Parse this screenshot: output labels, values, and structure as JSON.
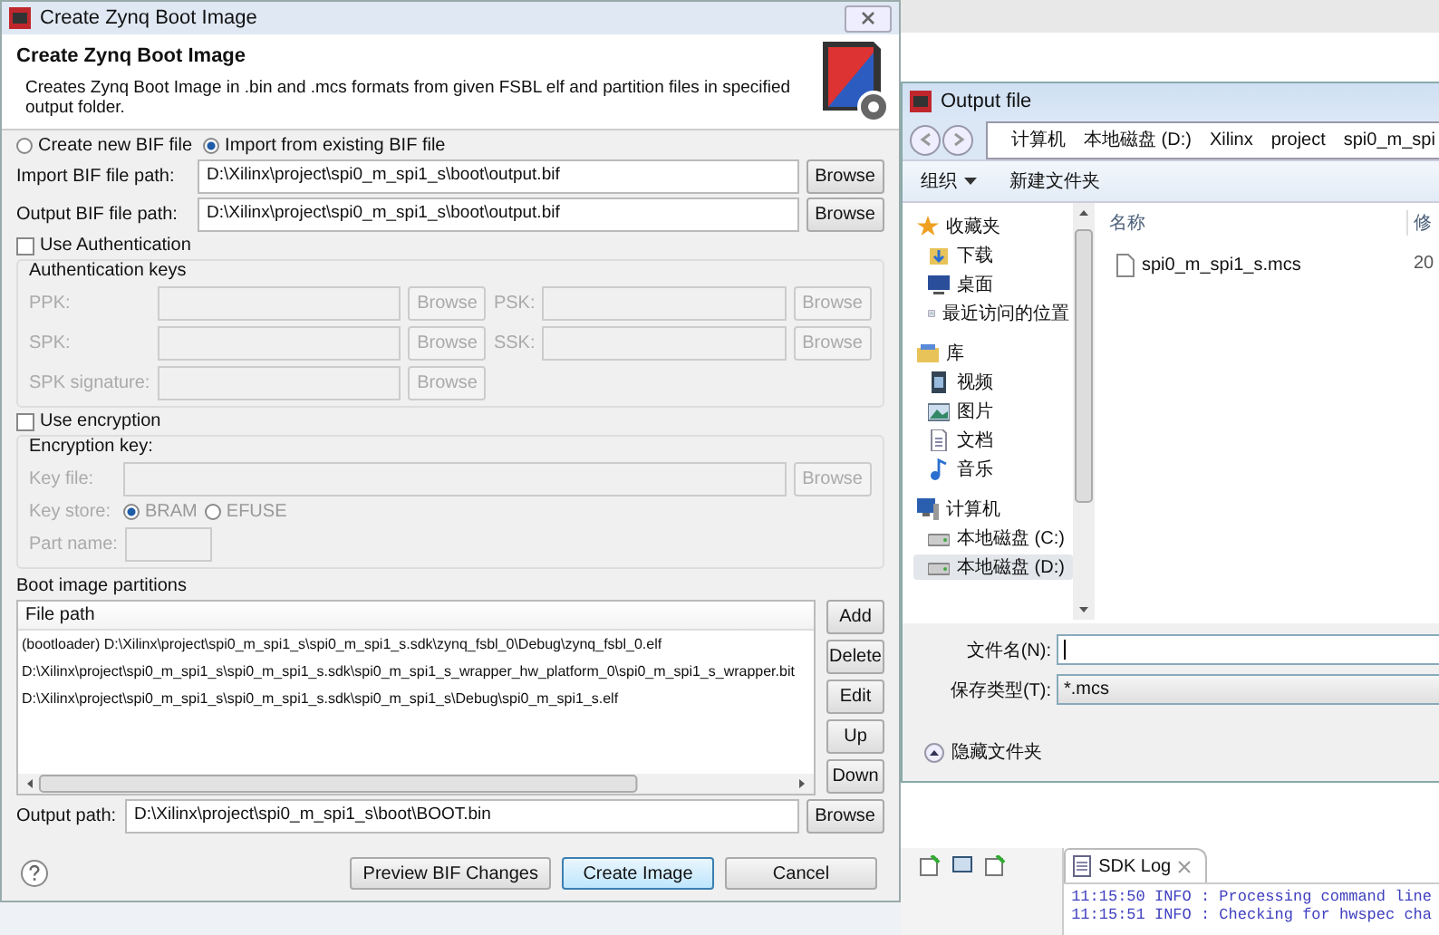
{
  "main_dialog": {
    "title": "Create Zynq Boot Image",
    "heading": "Create Zynq Boot Image",
    "description": "Creates Zynq Boot Image in .bin and .mcs formats from given FSBL elf and partition files in specified output folder.",
    "bif_mode": [
      {
        "label": "Create new BIF file",
        "selected": false
      },
      {
        "label": "Import from existing BIF file",
        "selected": true
      }
    ],
    "bif_paths": [
      {
        "label": "Import BIF file path:",
        "value": "D:\\Xilinx\\project\\spi0_m_spi1_s\\boot\\output.bif",
        "button": "Browse"
      },
      {
        "label": "Output BIF file path:",
        "value": "D:\\Xilinx\\project\\spi0_m_spi1_s\\boot\\output.bif",
        "button": "Browse"
      }
    ],
    "authentication": {
      "label": "Use Authentication",
      "checked": false,
      "group_title": "Authentication keys",
      "keys": [
        {
          "label": "PPK:",
          "button": "Browse"
        },
        {
          "label": "PSK:",
          "button": "Browse"
        },
        {
          "label": "SPK:",
          "button": "Browse"
        },
        {
          "label": "SSK:",
          "button": "Browse"
        },
        {
          "label": "SPK signature:",
          "button": "Browse"
        }
      ]
    },
    "encryption": {
      "label": "Use encryption",
      "checked": false,
      "group_title": "Encryption key:",
      "key_file": {
        "label": "Key file:",
        "button": "Browse"
      },
      "key_store": {
        "label": "Key store:",
        "options": [
          {
            "label": "BRAM",
            "selected": true
          },
          {
            "label": "EFUSE",
            "selected": false
          }
        ]
      },
      "part_name": {
        "label": "Part name:"
      }
    },
    "partitions": {
      "title": "Boot image partitions",
      "column": "File path",
      "rows": [
        "(bootloader) D:\\Xilinx\\project\\spi0_m_spi1_s\\spi0_m_spi1_s.sdk\\zynq_fsbl_0\\Debug\\zynq_fsbl_0.elf",
        "D:\\Xilinx\\project\\spi0_m_spi1_s\\spi0_m_spi1_s.sdk\\spi0_m_spi1_s_wrapper_hw_platform_0\\spi0_m_spi1_s_wrapper.bit",
        "D:\\Xilinx\\project\\spi0_m_spi1_s\\spi0_m_spi1_s.sdk\\spi0_m_spi1_s\\Debug\\spi0_m_spi1_s.elf"
      ],
      "buttons": [
        "Add",
        "Delete",
        "Edit",
        "Up",
        "Down"
      ]
    },
    "output_path": {
      "label": "Output path:",
      "value": "D:\\Xilinx\\project\\spi0_m_spi1_s\\boot\\BOOT.bin",
      "button": "Browse"
    },
    "footer_buttons": [
      {
        "label": "Preview BIF Changes",
        "default": false
      },
      {
        "label": "Create Image",
        "default": true
      },
      {
        "label": "Cancel",
        "default": false
      }
    ]
  },
  "file_dialog": {
    "title": "Output file",
    "breadcrumb": [
      "计算机",
      "本地磁盘 (D:)",
      "Xilinx",
      "project",
      "spi0_m_spi"
    ],
    "toolbar": [
      {
        "label": "组织",
        "dropdown": true
      },
      {
        "label": "新建文件夹",
        "dropdown": false
      }
    ],
    "nav": [
      {
        "label": "收藏夹",
        "kind": "star",
        "selected": false,
        "children": [
          {
            "label": "下载",
            "kind": "download",
            "selected": false
          },
          {
            "label": "桌面",
            "kind": "desktop",
            "selected": false
          },
          {
            "label": "最近访问的位置",
            "kind": "recent",
            "selected": false
          }
        ]
      },
      {
        "label": "库",
        "kind": "library",
        "selected": false,
        "children": [
          {
            "label": "视频",
            "kind": "video",
            "selected": false
          },
          {
            "label": "图片",
            "kind": "picture",
            "selected": false
          },
          {
            "label": "文档",
            "kind": "document",
            "selected": false
          },
          {
            "label": "音乐",
            "kind": "music",
            "selected": false
          }
        ]
      },
      {
        "label": "计算机",
        "kind": "computer",
        "selected": false,
        "children": [
          {
            "label": "本地磁盘 (C:)",
            "kind": "drive",
            "selected": false
          },
          {
            "label": "本地磁盘 (D:)",
            "kind": "drive",
            "selected": true
          }
        ]
      }
    ],
    "columns": [
      "名称",
      "修"
    ],
    "files": [
      {
        "name": "spi0_m_spi1_s.mcs",
        "date": "20"
      }
    ],
    "file_name": {
      "label": "文件名(N):"
    },
    "file_type": {
      "label": "保存类型(T):",
      "value": "*.mcs"
    },
    "hide_folders": "隐藏文件夹"
  },
  "sdk_log": {
    "tab": "SDK Log",
    "lines": [
      {
        "time": "11:15:50",
        "level": "INFO",
        "message": ": Processing command line"
      },
      {
        "time": "11:15:51",
        "level": "INFO",
        "message": ": Checking for hwspec cha"
      }
    ]
  }
}
